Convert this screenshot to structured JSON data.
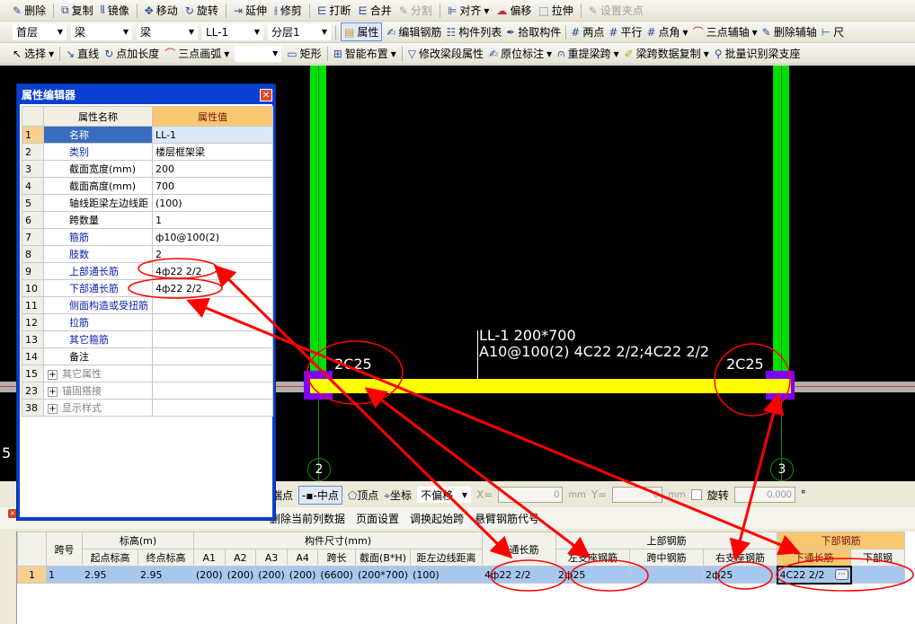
{
  "toolbar1": [
    "删除",
    "复制",
    "镜像",
    "移动",
    "旋转",
    "延伸",
    "修剪",
    "打断",
    "合并",
    "分割",
    "对齐",
    "偏移",
    "拉伸",
    "设置夹点"
  ],
  "toolbar2": {
    "floor": "首层",
    "type1": "梁",
    "type2": "梁",
    "component": "LL-1",
    "layer": "分层1",
    "buttons": [
      "属性",
      "编辑钢筋",
      "构件列表",
      "拾取构件",
      "两点",
      "平行",
      "点角",
      "三点辅轴",
      "删除辅轴",
      "尺"
    ]
  },
  "toolbar3": [
    "选择",
    "直线",
    "点加长度",
    "三点画弧",
    "矩形",
    "智能布置",
    "修改梁段属性",
    "原位标注",
    "重提梁跨",
    "梁跨数据复制",
    "批量识别梁支座"
  ],
  "canvas": {
    "label1": "LL-1 200*700",
    "label2": "A10@100(2) 4C22 2/2;4C22 2/2",
    "left_support": "2C25",
    "right_support": "2C25",
    "axis_left": "2",
    "axis_right": "3",
    "edge": "5"
  },
  "prop_editor": {
    "title": "属性编辑器",
    "col_name": "属性名称",
    "col_value": "属性值",
    "rows": [
      {
        "n": "1",
        "name": "名称",
        "value": "LL-1"
      },
      {
        "n": "2",
        "name": "类别",
        "value": "楼层框架梁"
      },
      {
        "n": "3",
        "name": "截面宽度(mm)",
        "value": "200"
      },
      {
        "n": "4",
        "name": "截面高度(mm)",
        "value": "700"
      },
      {
        "n": "5",
        "name": "轴线距梁左边线距",
        "value": "(100)"
      },
      {
        "n": "6",
        "name": "跨数量",
        "value": "1"
      },
      {
        "n": "7",
        "name": "箍筋",
        "value": "ф10@100(2)"
      },
      {
        "n": "8",
        "name": "肢数",
        "value": "2"
      },
      {
        "n": "9",
        "name": "上部通长筋",
        "value": "4ф22 2/2"
      },
      {
        "n": "10",
        "name": "下部通长筋",
        "value": "4ф22 2/2"
      },
      {
        "n": "11",
        "name": "侧面构造或受扭筋",
        "value": ""
      },
      {
        "n": "12",
        "name": "拉筋",
        "value": ""
      },
      {
        "n": "13",
        "name": "其它箍筋",
        "value": ""
      },
      {
        "n": "14",
        "name": "备注",
        "value": ""
      },
      {
        "n": "15",
        "name": "其它属性",
        "value": ""
      },
      {
        "n": "23",
        "name": "锚固搭接",
        "value": ""
      },
      {
        "n": "38",
        "name": "显示样式",
        "value": ""
      }
    ]
  },
  "snap": {
    "items": [
      "端点",
      "中点",
      "顶点",
      "坐标"
    ],
    "offset": "不偏移",
    "x_label": "X=",
    "x": "0",
    "unit": "mm",
    "y_label": "Y=",
    "y": "0",
    "rotate": "旋转",
    "angle": "0.000",
    "deg": "°"
  },
  "toolbar4": [
    "删除当前列数据",
    "页面设置",
    "调换起始跨",
    "悬臂钢筋代号"
  ],
  "grid": {
    "h_span": "跨号",
    "h_elev": "标高(m)",
    "h_size": "构件尺寸(mm)",
    "h_top_through": "上通长筋",
    "h_top": "上部钢筋",
    "h_bottom": "下部钢筋",
    "sub": [
      "起点标高",
      "终点标高",
      "A1",
      "A2",
      "A3",
      "A4",
      "跨长",
      "截面(B*H)",
      "距左边线距离",
      "左支座钢筋",
      "跨中钢筋",
      "右支座钢筋",
      "下通长筋",
      "下部钢"
    ],
    "row": [
      "1",
      "1",
      "2.95",
      "2.95",
      "(200)",
      "(200)",
      "(200)",
      "(200)",
      "(6600)",
      "(200*700)",
      "(100)",
      "4ф22 2/2",
      "2ф25",
      "",
      "2ф25",
      "4C22 2/2",
      ""
    ]
  },
  "colors": {
    "beam": "#ffff00",
    "column": "#00e000",
    "support": "#8000ff",
    "annotation": "#ff0000"
  }
}
